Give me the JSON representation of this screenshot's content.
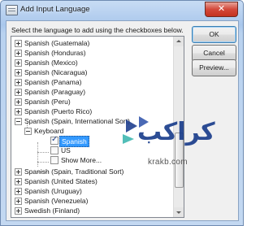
{
  "window": {
    "title": "Add Input Language",
    "close_glyph": "✕"
  },
  "instruction": "Select the language to add using the checkboxes below.",
  "tree": {
    "items": [
      {
        "label": "Spanish (Guatemala)",
        "expander": "+"
      },
      {
        "label": "Spanish (Honduras)",
        "expander": "+"
      },
      {
        "label": "Spanish (Mexico)",
        "expander": "+"
      },
      {
        "label": "Spanish (Nicaragua)",
        "expander": "+"
      },
      {
        "label": "Spanish (Panama)",
        "expander": "+"
      },
      {
        "label": "Spanish (Paraguay)",
        "expander": "+"
      },
      {
        "label": "Spanish (Peru)",
        "expander": "+"
      },
      {
        "label": "Spanish (Puerto Rico)",
        "expander": "+"
      },
      {
        "label": "Spanish (Spain, International Sort)",
        "expander": "-"
      },
      {
        "label": "Keyboard",
        "expander": "-"
      },
      {
        "label": "Spanish",
        "checked": true,
        "selected": true
      },
      {
        "label": "US",
        "checked": false
      },
      {
        "label": "Show More...",
        "checked": false
      },
      {
        "label": "Spanish (Spain, Traditional Sort)",
        "expander": "+"
      },
      {
        "label": "Spanish (United States)",
        "expander": "+"
      },
      {
        "label": "Spanish (Uruguay)",
        "expander": "+"
      },
      {
        "label": "Spanish (Venezuela)",
        "expander": "+"
      },
      {
        "label": "Swedish (Finland)",
        "expander": "+"
      }
    ]
  },
  "buttons": {
    "ok": "OK",
    "cancel": "Cancel",
    "preview": "Preview..."
  },
  "watermark": {
    "logo_text": "كراكب",
    "url": "krakb.com"
  }
}
